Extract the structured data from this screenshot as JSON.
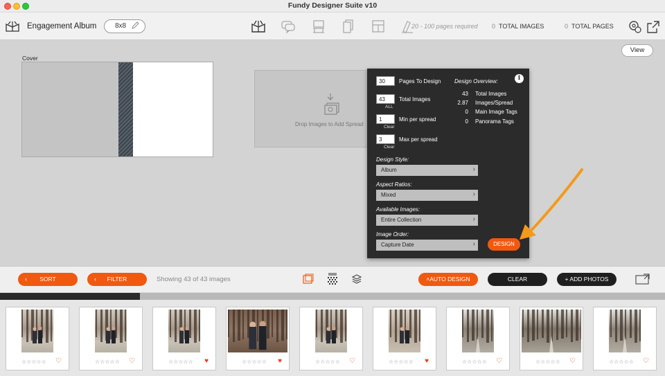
{
  "app": {
    "title": "Fundy Designer Suite v10"
  },
  "toolbar": {
    "album_name": "Engagement Album",
    "size": "8x8",
    "pages_required": "20 - 100 pages required",
    "total_images_count": "0",
    "total_images_label": "TOTAL IMAGES",
    "total_pages_count": "0",
    "total_pages_label": "TOTAL PAGES"
  },
  "workspace": {
    "view_label": "View",
    "cover_label": "Cover",
    "drop_text": "Drop Images to Add Spread"
  },
  "panel": {
    "pages_to_design": {
      "value": "30",
      "label": "Pages To Design"
    },
    "total_images": {
      "value": "43",
      "sub": "ALL",
      "label": "Total Images"
    },
    "min_per_spread": {
      "value": "1",
      "sub": "Clear",
      "label": "Min per spread"
    },
    "max_per_spread": {
      "value": "3",
      "sub": "Clear",
      "label": "Max per spread"
    },
    "overview_title": "Design Overview:",
    "overview": [
      {
        "value": "43",
        "label": "Total Images"
      },
      {
        "value": "2.87",
        "label": "Images/Spread"
      },
      {
        "value": "0",
        "label": "Main Image Tags"
      },
      {
        "value": "0",
        "label": "Panorama Tags"
      }
    ],
    "design_style": {
      "label": "Design Style:",
      "value": "Album"
    },
    "aspect_ratios": {
      "label": "Aspect Ratios:",
      "value": "Mixed"
    },
    "available_images": {
      "label": "Available Images:",
      "value": "Entire Collection"
    },
    "image_order": {
      "label": "Image Order:",
      "value": "Capture Date"
    },
    "design_button": "DESIGN"
  },
  "actionbar": {
    "sort": "SORT",
    "filter": "FILTER",
    "showing": "Showing 43 of 43 images",
    "auto_design": "AUTO DESIGN",
    "clear": "CLEAR",
    "add_photos": "+ ADD PHOTOS"
  },
  "progress": {
    "fraction": 0.21
  },
  "colors": {
    "accent": "#f0590f",
    "panel": "#2b2b2b",
    "dark_button": "#1f1f1f"
  },
  "filmstrip": [
    {
      "favorite": false,
      "scene": "forest-couple"
    },
    {
      "favorite": false,
      "scene": "forest-couple"
    },
    {
      "favorite": true,
      "scene": "forest-couple"
    },
    {
      "favorite": true,
      "scene": "couple-closeup"
    },
    {
      "favorite": false,
      "scene": "forest-couple"
    },
    {
      "favorite": true,
      "scene": "couple-embrace"
    },
    {
      "favorite": false,
      "scene": "forest-path"
    },
    {
      "favorite": false,
      "scene": "forest-path-wide"
    },
    {
      "favorite": false,
      "scene": "forest-path"
    }
  ]
}
